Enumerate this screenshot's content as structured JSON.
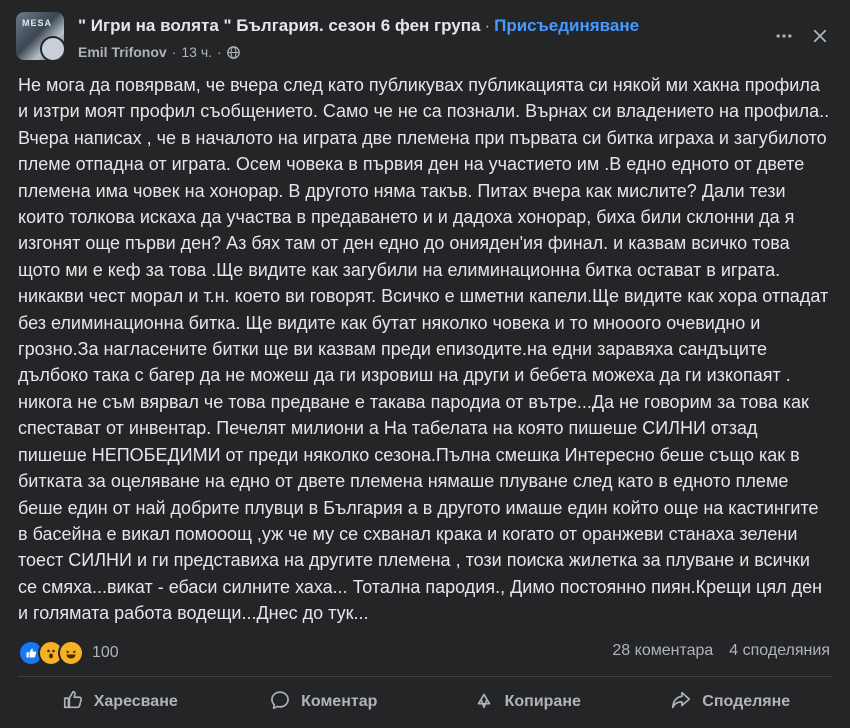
{
  "header": {
    "group_name": "\" Игри на волята \" България. сезон 6 фен група",
    "separator": "·",
    "join_label": "Присъединяване",
    "author": "Emil Trifonov",
    "time_separator": "·",
    "time": "13 ч.",
    "avatar_text": "MESA",
    "icons": {
      "privacy": "globe-icon",
      "more": "more-icon",
      "close": "close-icon"
    }
  },
  "post": {
    "text": "Не мога да повярвам, че вчера след като публикувах публикацията си някой ми хакна профила и изтри моят профил съобщението. Само че не са познали. Върнах си владението на профила.. Вчера написах  , че в началото на играта две племена  при първата си битка играха и загубилото племе отпадна от играта. Осем човека в първия ден на участието им  .В едно едното от двете племена има човек на хонорар. В другото няма такъв. Питах вчера как мислите? Дали тези които толкова искаха да участва в предаването и и  дадоха хонорар, биха били склонни да я изгонят още първи ден? Аз бях там от ден едно до онияден'ия финал. и казвам всичко това щото ми е кеф за това .Ще видите как загубили на елиминационна битка остават в играта. никакви чест морал и т.н. което ви говорят. Всичко е шметни капели.Ще видите как хора  отпадат без елиминационна битка. Ще видите как бутат няколко човека и то мнооого очевидно и грозно.За нагласените битки ще ви казвам преди епизодите.на едни заравяха сандъците дълбоко така с багер да не можеш да ги изровиш на други и бебета можеха да ги изкопаят .  никога не съм вярвал че това предване е такава пародиа от вътре...Да не говорим за това как спестават от инвентар. Печелят милиони а На табелата на която пишеше СИЛНИ отзад пишеше НЕПОБЕДИМИ от преди няколко сезона.Пълна смешка Интересно беше също как в битката за оцеляване на едно от двете племена нямаше плуване след като в едното племе беше един от най добрите плувци в България а в другото имаше един  който още на кастингите в басейна е викал помооощ ,уж че му се схванал крака и когато от оранжеви станаха зелени тоест СИЛНИ и ги представиха на другите племена , този поиска жилетка за плуване и всички се смяха...викат - ебаси силните хаха... Тотална пародия., Димо постоянно пиян.Крещи цял ден и голямата работа водещи...Днес до тук..."
  },
  "stats": {
    "reaction_types": [
      "like",
      "wow",
      "haha"
    ],
    "reaction_count": "100",
    "comments": "28 коментара",
    "shares": "4 споделяния"
  },
  "actions": {
    "like": "Харесване",
    "comment": "Коментар",
    "copy": "Копиране",
    "share": "Споделяне"
  },
  "colors": {
    "background": "#242526",
    "text": "#e4e6eb",
    "secondary": "#b0b3b8",
    "link": "#4599ff",
    "divider": "#3e4042"
  }
}
